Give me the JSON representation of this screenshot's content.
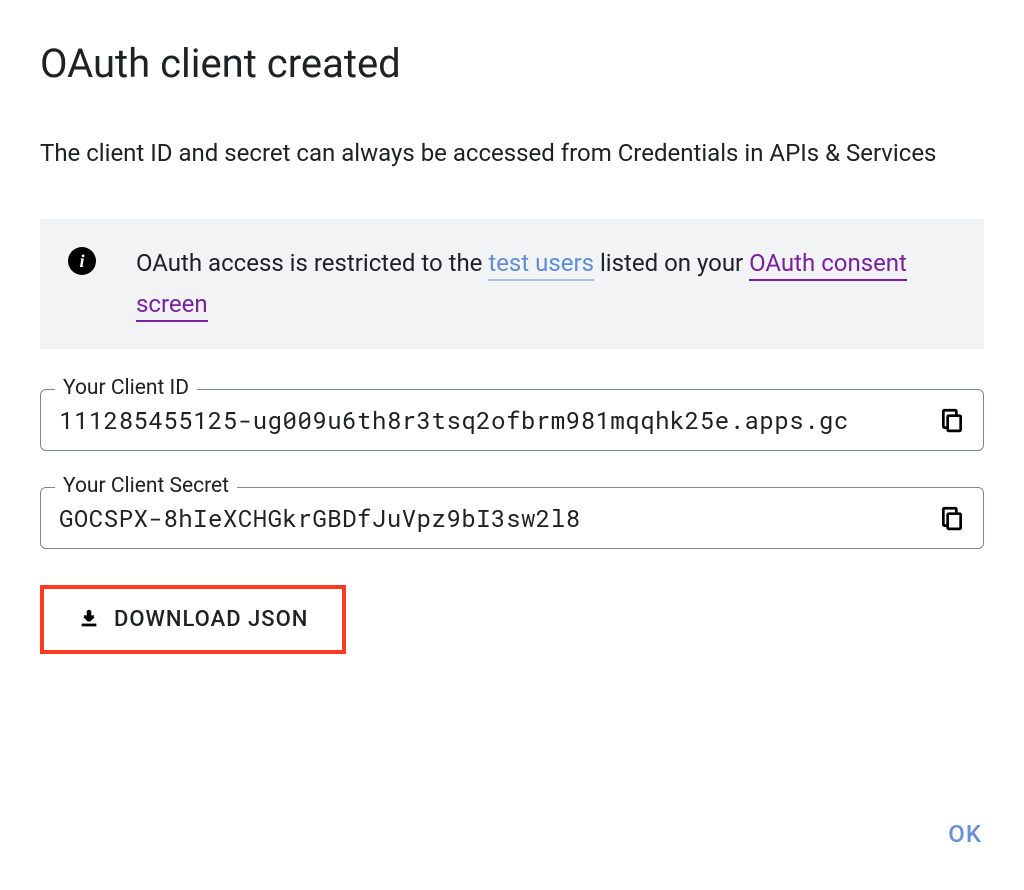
{
  "title": "OAuth client created",
  "description": "The client ID and secret can always be accessed from Credentials in APIs & Services",
  "info_banner": {
    "text_prefix": "OAuth access is restricted to the ",
    "link_test_users": "test users",
    "text_middle": " listed on your ",
    "link_consent_screen": "OAuth consent screen"
  },
  "client_id": {
    "label": "Your Client ID",
    "value": "111285455125-ug009u6th8r3tsq2ofbrm981mqqhk25e.apps.gc"
  },
  "client_secret": {
    "label": "Your Client Secret",
    "value": "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"
  },
  "download_button": "DOWNLOAD JSON",
  "ok_button": "OK"
}
